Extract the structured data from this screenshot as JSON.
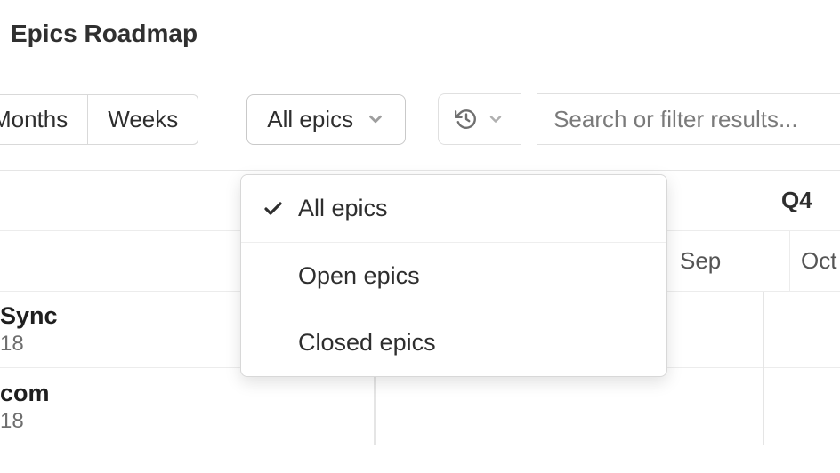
{
  "header": {
    "title": "Epics Roadmap"
  },
  "zoom": {
    "months_label": "Months",
    "weeks_label": "Weeks"
  },
  "filter": {
    "selected_label": "All epics",
    "options": {
      "all": "All epics",
      "open": "Open epics",
      "closed": "Closed epics"
    }
  },
  "search": {
    "placeholder": "Search or filter results..."
  },
  "timeline": {
    "quarter": "Q4",
    "months": {
      "sep": "Sep",
      "oct": "Oct"
    }
  },
  "epics": {
    "row1": {
      "title": "Sync",
      "sub": "18"
    },
    "row2": {
      "title": "com",
      "sub": "18"
    }
  }
}
